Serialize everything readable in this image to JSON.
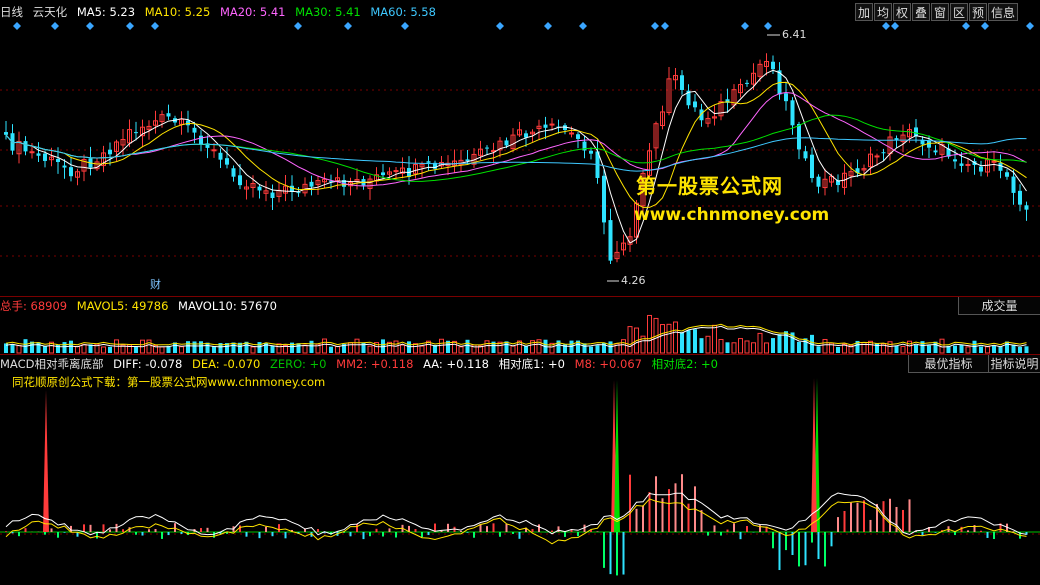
{
  "main_legend": {
    "period": "日线",
    "stock": "云天化",
    "ma": [
      {
        "label": "MA5: 5.23",
        "color": "#ffffff"
      },
      {
        "label": "MA10: 5.25",
        "color": "#ffe400"
      },
      {
        "label": "MA20: 5.41",
        "color": "#ff66ff"
      },
      {
        "label": "MA30: 5.41",
        "color": "#00e000"
      },
      {
        "label": "MA60: 5.58",
        "color": "#3ec8ff"
      }
    ]
  },
  "toolbar": [
    "加",
    "均",
    "权",
    "叠",
    "窗",
    "区",
    "预",
    "信息"
  ],
  "price_labels": {
    "high": "6.41",
    "low": "4.26"
  },
  "cai_label": "财",
  "watermark": {
    "line1": "第一股票公式网",
    "line2": "www.chnmoney.com"
  },
  "volume_legend": {
    "label": "总手",
    "value": "68909",
    "mavol5": "MAVOL5: 49786",
    "mavol10": "MAVOL10: 57670",
    "button": "成交量"
  },
  "macd_legend": {
    "name": "MACD相对乖离底部",
    "items": [
      {
        "label": "DIFF: -0.078",
        "color": "#ffffff"
      },
      {
        "label": "DEA: -0.070",
        "color": "#ffe400"
      },
      {
        "label": "ZERO: +0",
        "color": "#00c000"
      },
      {
        "label": "MM2: +0.118",
        "color": "#ff3b3b"
      },
      {
        "label": "AA: +0.118",
        "color": "#ffffff"
      },
      {
        "label": "相对底1: +0",
        "color": "#ffffff"
      },
      {
        "label": "M8: +0.067",
        "color": "#ff3b3b"
      },
      {
        "label": "相对底2: +0",
        "color": "#00e000"
      }
    ],
    "buttons": [
      "最优指标",
      "指标说明"
    ]
  },
  "promo_text": "同花顺原创公式下载：第一股票公式网www.chnmoney.com",
  "colors": {
    "up": "#ff3b3b",
    "down": "#2ee3ff",
    "grid": "#7a0000"
  }
}
